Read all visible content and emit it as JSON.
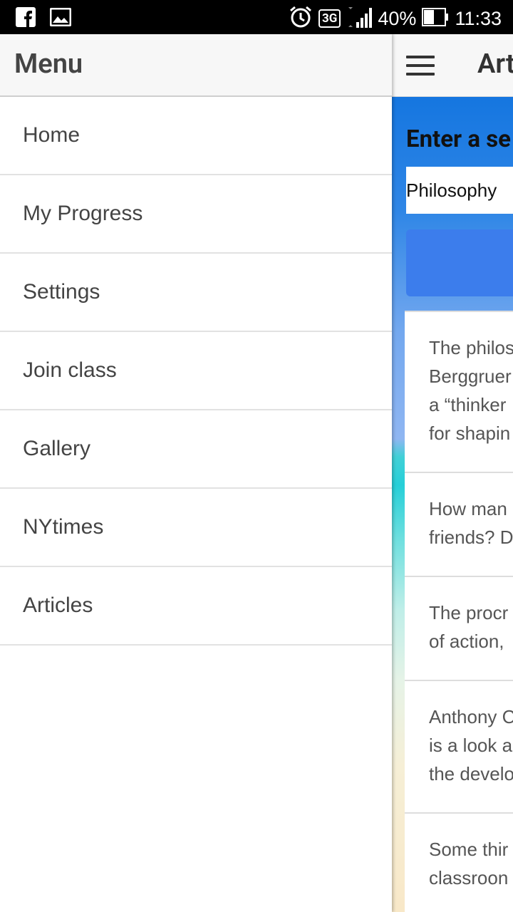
{
  "status_bar": {
    "network": "3G",
    "battery": "40%",
    "time": "11:33",
    "icons": [
      "facebook-icon",
      "photo-icon",
      "alarm-icon",
      "signal-icon",
      "battery-icon"
    ]
  },
  "drawer": {
    "title": "Menu",
    "items": [
      {
        "label": "Home"
      },
      {
        "label": "My Progress"
      },
      {
        "label": "Settings"
      },
      {
        "label": "Join class"
      },
      {
        "label": "Gallery"
      },
      {
        "label": "NYtimes"
      },
      {
        "label": "Articles"
      }
    ]
  },
  "content": {
    "title": "Art",
    "prompt": "Enter a se",
    "search_value": "Philosophy",
    "articles": [
      {
        "text": "The philos\nBerggruer\na “thinker\nfor shapin"
      },
      {
        "text": "How man\nfriends? D"
      },
      {
        "text": "The procr\nof action,"
      },
      {
        "text": "Anthony C\nis a look a\nthe develo"
      },
      {
        "text": "Some thir\nclassroon"
      }
    ]
  },
  "colors": {
    "status_bar": "#000000",
    "toolbar": "#f7f7f7",
    "search_button": "#3c7dec",
    "text_dark": "#444444"
  }
}
